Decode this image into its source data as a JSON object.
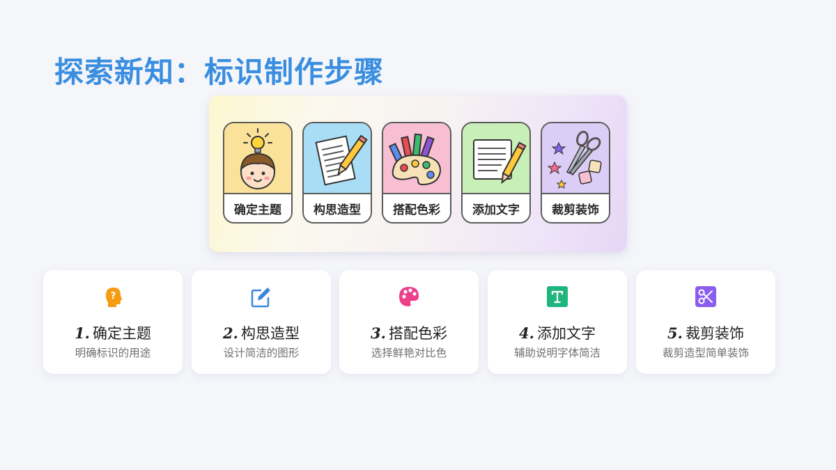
{
  "title": "探索新知：标识制作步骤",
  "banner": {
    "tiles": [
      {
        "label": "确定主题",
        "icon": "thinking-head-lightbulb-icon",
        "bg": "#fbe29a"
      },
      {
        "label": "构思造型",
        "icon": "paper-pencil-sketch-icon",
        "bg": "#a9ddf6"
      },
      {
        "label": "搭配色彩",
        "icon": "palette-crayons-icon",
        "bg": "#f8bfd3"
      },
      {
        "label": "添加文字",
        "icon": "notepad-pencil-icon",
        "bg": "#c9efb8"
      },
      {
        "label": "裁剪装饰",
        "icon": "scissors-stickers-icon",
        "bg": "#dccdf6"
      }
    ]
  },
  "steps": [
    {
      "num": "1.",
      "title": "确定主题",
      "desc": "明确标识的用途",
      "icon": "head-question-icon",
      "color": "#f39c12"
    },
    {
      "num": "2.",
      "title": "构思造型",
      "desc": "设计简洁的图形",
      "icon": "edit-icon",
      "color": "#3a86d9"
    },
    {
      "num": "3.",
      "title": "搭配色彩",
      "desc": "选择鲜艳对比色",
      "icon": "palette-icon",
      "color": "#ec3f8c"
    },
    {
      "num": "4.",
      "title": "添加文字",
      "desc": "辅助说明字体简洁",
      "icon": "text-t-icon",
      "color": "#1fb57e"
    },
    {
      "num": "5.",
      "title": "裁剪装饰",
      "desc": "裁剪造型简单装饰",
      "icon": "scissors-icon",
      "color": "#8a5cf0"
    }
  ]
}
